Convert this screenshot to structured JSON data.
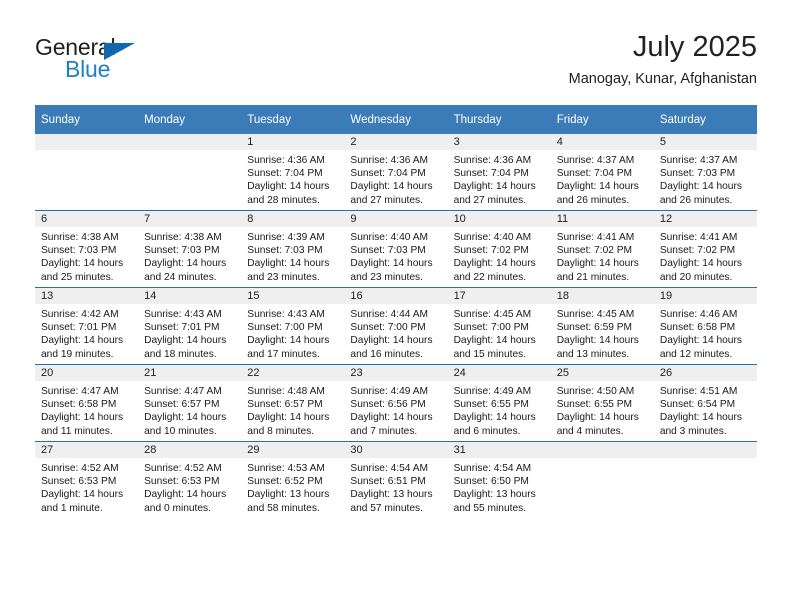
{
  "brand": {
    "name_part1": "General",
    "name_part2": "Blue",
    "triangle_color": "#1166b0",
    "blue_color": "#1f7fc4"
  },
  "header": {
    "title": "July 2025",
    "subtitle": "Manogay, Kunar, Afghanistan"
  },
  "theme": {
    "header_bg": "#3b7cb8",
    "row_divider": "#2d6ca8",
    "daynum_band": "#efefef"
  },
  "weekdays": [
    "Sunday",
    "Monday",
    "Tuesday",
    "Wednesday",
    "Thursday",
    "Friday",
    "Saturday"
  ],
  "labels": {
    "sunrise": "Sunrise:",
    "sunset": "Sunset:",
    "daylight": "Daylight:"
  },
  "weeks": [
    [
      {
        "day": "",
        "sunrise": "",
        "sunset": "",
        "daylight_line1": "",
        "daylight_line2": ""
      },
      {
        "day": "",
        "sunrise": "",
        "sunset": "",
        "daylight_line1": "",
        "daylight_line2": ""
      },
      {
        "day": "1",
        "sunrise": "Sunrise: 4:36 AM",
        "sunset": "Sunset: 7:04 PM",
        "daylight_line1": "Daylight: 14 hours",
        "daylight_line2": "and 28 minutes."
      },
      {
        "day": "2",
        "sunrise": "Sunrise: 4:36 AM",
        "sunset": "Sunset: 7:04 PM",
        "daylight_line1": "Daylight: 14 hours",
        "daylight_line2": "and 27 minutes."
      },
      {
        "day": "3",
        "sunrise": "Sunrise: 4:36 AM",
        "sunset": "Sunset: 7:04 PM",
        "daylight_line1": "Daylight: 14 hours",
        "daylight_line2": "and 27 minutes."
      },
      {
        "day": "4",
        "sunrise": "Sunrise: 4:37 AM",
        "sunset": "Sunset: 7:04 PM",
        "daylight_line1": "Daylight: 14 hours",
        "daylight_line2": "and 26 minutes."
      },
      {
        "day": "5",
        "sunrise": "Sunrise: 4:37 AM",
        "sunset": "Sunset: 7:03 PM",
        "daylight_line1": "Daylight: 14 hours",
        "daylight_line2": "and 26 minutes."
      }
    ],
    [
      {
        "day": "6",
        "sunrise": "Sunrise: 4:38 AM",
        "sunset": "Sunset: 7:03 PM",
        "daylight_line1": "Daylight: 14 hours",
        "daylight_line2": "and 25 minutes."
      },
      {
        "day": "7",
        "sunrise": "Sunrise: 4:38 AM",
        "sunset": "Sunset: 7:03 PM",
        "daylight_line1": "Daylight: 14 hours",
        "daylight_line2": "and 24 minutes."
      },
      {
        "day": "8",
        "sunrise": "Sunrise: 4:39 AM",
        "sunset": "Sunset: 7:03 PM",
        "daylight_line1": "Daylight: 14 hours",
        "daylight_line2": "and 23 minutes."
      },
      {
        "day": "9",
        "sunrise": "Sunrise: 4:40 AM",
        "sunset": "Sunset: 7:03 PM",
        "daylight_line1": "Daylight: 14 hours",
        "daylight_line2": "and 23 minutes."
      },
      {
        "day": "10",
        "sunrise": "Sunrise: 4:40 AM",
        "sunset": "Sunset: 7:02 PM",
        "daylight_line1": "Daylight: 14 hours",
        "daylight_line2": "and 22 minutes."
      },
      {
        "day": "11",
        "sunrise": "Sunrise: 4:41 AM",
        "sunset": "Sunset: 7:02 PM",
        "daylight_line1": "Daylight: 14 hours",
        "daylight_line2": "and 21 minutes."
      },
      {
        "day": "12",
        "sunrise": "Sunrise: 4:41 AM",
        "sunset": "Sunset: 7:02 PM",
        "daylight_line1": "Daylight: 14 hours",
        "daylight_line2": "and 20 minutes."
      }
    ],
    [
      {
        "day": "13",
        "sunrise": "Sunrise: 4:42 AM",
        "sunset": "Sunset: 7:01 PM",
        "daylight_line1": "Daylight: 14 hours",
        "daylight_line2": "and 19 minutes."
      },
      {
        "day": "14",
        "sunrise": "Sunrise: 4:43 AM",
        "sunset": "Sunset: 7:01 PM",
        "daylight_line1": "Daylight: 14 hours",
        "daylight_line2": "and 18 minutes."
      },
      {
        "day": "15",
        "sunrise": "Sunrise: 4:43 AM",
        "sunset": "Sunset: 7:00 PM",
        "daylight_line1": "Daylight: 14 hours",
        "daylight_line2": "and 17 minutes."
      },
      {
        "day": "16",
        "sunrise": "Sunrise: 4:44 AM",
        "sunset": "Sunset: 7:00 PM",
        "daylight_line1": "Daylight: 14 hours",
        "daylight_line2": "and 16 minutes."
      },
      {
        "day": "17",
        "sunrise": "Sunrise: 4:45 AM",
        "sunset": "Sunset: 7:00 PM",
        "daylight_line1": "Daylight: 14 hours",
        "daylight_line2": "and 15 minutes."
      },
      {
        "day": "18",
        "sunrise": "Sunrise: 4:45 AM",
        "sunset": "Sunset: 6:59 PM",
        "daylight_line1": "Daylight: 14 hours",
        "daylight_line2": "and 13 minutes."
      },
      {
        "day": "19",
        "sunrise": "Sunrise: 4:46 AM",
        "sunset": "Sunset: 6:58 PM",
        "daylight_line1": "Daylight: 14 hours",
        "daylight_line2": "and 12 minutes."
      }
    ],
    [
      {
        "day": "20",
        "sunrise": "Sunrise: 4:47 AM",
        "sunset": "Sunset: 6:58 PM",
        "daylight_line1": "Daylight: 14 hours",
        "daylight_line2": "and 11 minutes."
      },
      {
        "day": "21",
        "sunrise": "Sunrise: 4:47 AM",
        "sunset": "Sunset: 6:57 PM",
        "daylight_line1": "Daylight: 14 hours",
        "daylight_line2": "and 10 minutes."
      },
      {
        "day": "22",
        "sunrise": "Sunrise: 4:48 AM",
        "sunset": "Sunset: 6:57 PM",
        "daylight_line1": "Daylight: 14 hours",
        "daylight_line2": "and 8 minutes."
      },
      {
        "day": "23",
        "sunrise": "Sunrise: 4:49 AM",
        "sunset": "Sunset: 6:56 PM",
        "daylight_line1": "Daylight: 14 hours",
        "daylight_line2": "and 7 minutes."
      },
      {
        "day": "24",
        "sunrise": "Sunrise: 4:49 AM",
        "sunset": "Sunset: 6:55 PM",
        "daylight_line1": "Daylight: 14 hours",
        "daylight_line2": "and 6 minutes."
      },
      {
        "day": "25",
        "sunrise": "Sunrise: 4:50 AM",
        "sunset": "Sunset: 6:55 PM",
        "daylight_line1": "Daylight: 14 hours",
        "daylight_line2": "and 4 minutes."
      },
      {
        "day": "26",
        "sunrise": "Sunrise: 4:51 AM",
        "sunset": "Sunset: 6:54 PM",
        "daylight_line1": "Daylight: 14 hours",
        "daylight_line2": "and 3 minutes."
      }
    ],
    [
      {
        "day": "27",
        "sunrise": "Sunrise: 4:52 AM",
        "sunset": "Sunset: 6:53 PM",
        "daylight_line1": "Daylight: 14 hours",
        "daylight_line2": "and 1 minute."
      },
      {
        "day": "28",
        "sunrise": "Sunrise: 4:52 AM",
        "sunset": "Sunset: 6:53 PM",
        "daylight_line1": "Daylight: 14 hours",
        "daylight_line2": "and 0 minutes."
      },
      {
        "day": "29",
        "sunrise": "Sunrise: 4:53 AM",
        "sunset": "Sunset: 6:52 PM",
        "daylight_line1": "Daylight: 13 hours",
        "daylight_line2": "and 58 minutes."
      },
      {
        "day": "30",
        "sunrise": "Sunrise: 4:54 AM",
        "sunset": "Sunset: 6:51 PM",
        "daylight_line1": "Daylight: 13 hours",
        "daylight_line2": "and 57 minutes."
      },
      {
        "day": "31",
        "sunrise": "Sunrise: 4:54 AM",
        "sunset": "Sunset: 6:50 PM",
        "daylight_line1": "Daylight: 13 hours",
        "daylight_line2": "and 55 minutes."
      },
      {
        "day": "",
        "sunrise": "",
        "sunset": "",
        "daylight_line1": "",
        "daylight_line2": ""
      },
      {
        "day": "",
        "sunrise": "",
        "sunset": "",
        "daylight_line1": "",
        "daylight_line2": ""
      }
    ]
  ]
}
